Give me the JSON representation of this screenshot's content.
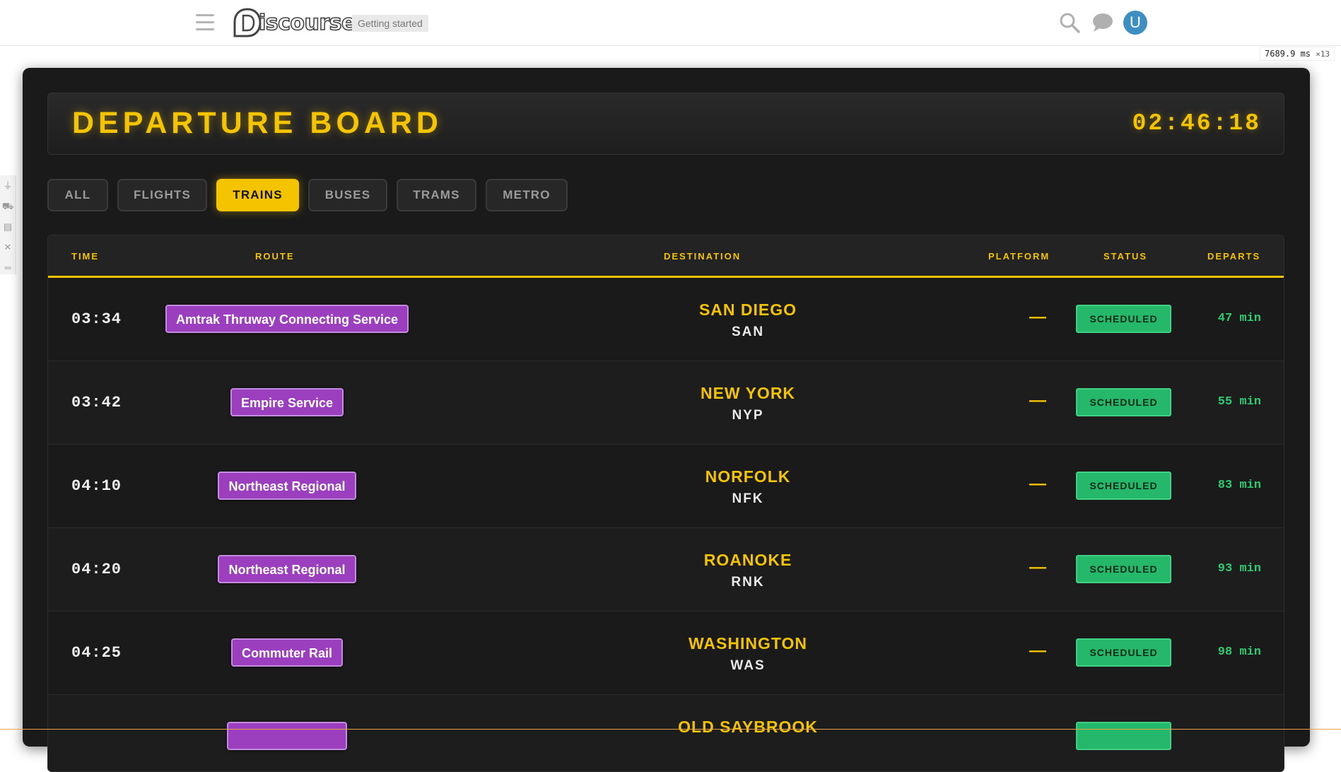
{
  "header": {
    "logo_text": "iscourse",
    "topic_badge": "Getting started",
    "avatar_letter": "U"
  },
  "perf": {
    "value": "7689.9 ms",
    "count": "×13"
  },
  "board": {
    "title": "DEPARTURE BOARD",
    "clock": "02:46:18",
    "tabs": [
      {
        "label": "ALL",
        "active": false
      },
      {
        "label": "FLIGHTS",
        "active": false
      },
      {
        "label": "TRAINS",
        "active": true
      },
      {
        "label": "BUSES",
        "active": false
      },
      {
        "label": "TRAMS",
        "active": false
      },
      {
        "label": "METRO",
        "active": false
      }
    ],
    "columns": {
      "time": "TIME",
      "route": "ROUTE",
      "destination": "DESTINATION",
      "platform": "PLATFORM",
      "status": "STATUS",
      "departs": "DEPARTS"
    },
    "rows": [
      {
        "time": "03:34",
        "route": "Amtrak Thruway Connecting Service",
        "city": "SAN DIEGO",
        "code": "SAN",
        "platform": "—",
        "status": "SCHEDULED",
        "departs": "47 min"
      },
      {
        "time": "03:42",
        "route": "Empire Service",
        "city": "NEW YORK",
        "code": "NYP",
        "platform": "—",
        "status": "SCHEDULED",
        "departs": "55 min"
      },
      {
        "time": "04:10",
        "route": "Northeast Regional",
        "city": "NORFOLK",
        "code": "NFK",
        "platform": "—",
        "status": "SCHEDULED",
        "departs": "83 min"
      },
      {
        "time": "04:20",
        "route": "Northeast Regional",
        "city": "ROANOKE",
        "code": "RNK",
        "platform": "—",
        "status": "SCHEDULED",
        "departs": "93 min"
      },
      {
        "time": "04:25",
        "route": "Commuter Rail",
        "city": "WASHINGTON",
        "code": "WAS",
        "platform": "—",
        "status": "SCHEDULED",
        "departs": "98 min"
      },
      {
        "time": "",
        "route": "",
        "city": "OLD SAYBROOK",
        "code": "",
        "platform": "",
        "status": "",
        "departs": ""
      }
    ]
  },
  "colors": {
    "accent": "#f5c400",
    "route": "#9b3fbf",
    "status": "#25b86a",
    "departs": "#2ecc71"
  }
}
